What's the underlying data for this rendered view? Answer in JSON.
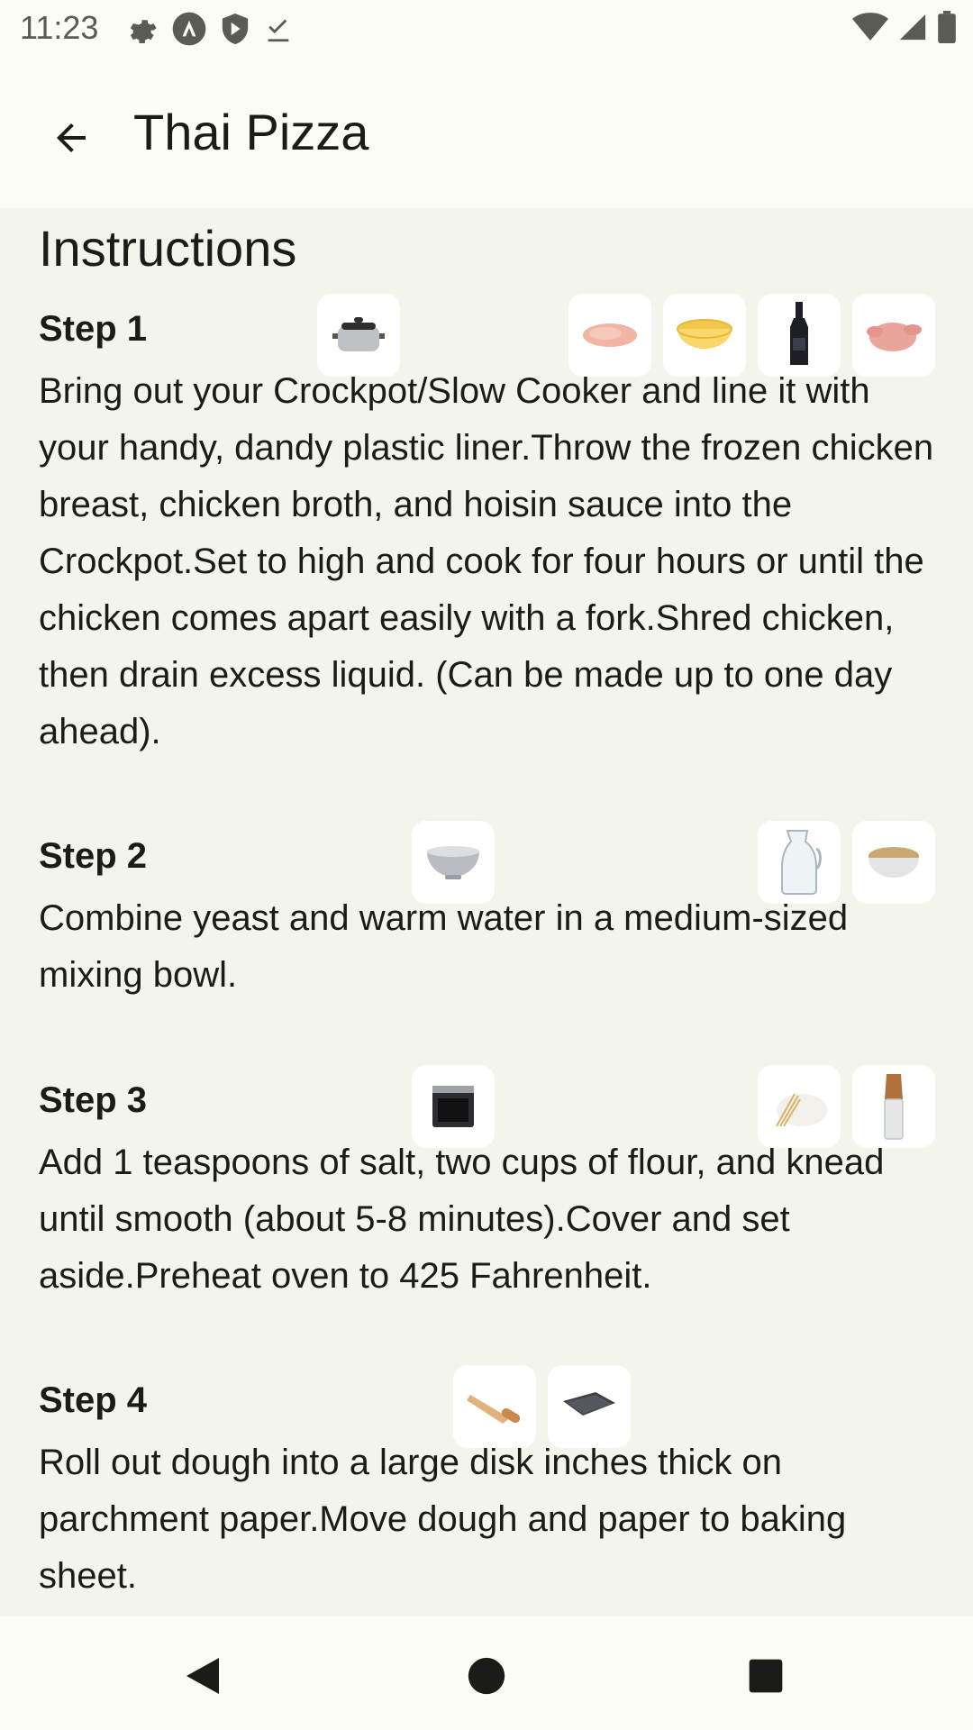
{
  "status_bar": {
    "time": "11:23",
    "icons_left": [
      "gear-icon",
      "a-icon",
      "shield-icon",
      "download-done-icon"
    ],
    "icons_right": [
      "wifi-icon",
      "signal-icon",
      "battery-icon"
    ]
  },
  "app_bar": {
    "back_icon": "arrow-back-icon",
    "title": "Thai Pizza"
  },
  "content": {
    "section_title": "Instructions",
    "steps": [
      {
        "label": "Step 1",
        "equipment": [
          "slow-cooker-image"
        ],
        "ingredients": [
          "chicken-breast-image",
          "chicken-broth-image",
          "hoisin-sauce-image",
          "raw-chicken-image"
        ],
        "text": "Bring out your Crockpot/Slow Cooker and line it with your handy, dandy plastic liner.Throw the frozen chicken breast, chicken broth, and hoisin sauce into the Crockpot.Set to high and cook for four hours or until the chicken comes apart easily with a fork.Shred chicken, then drain excess liquid. (Can be made up to one day ahead)."
      },
      {
        "label": "Step 2",
        "equipment": [
          "mixing-bowl-image"
        ],
        "ingredients": [
          "water-jug-image",
          "yeast-image"
        ],
        "text": "Combine yeast and warm water in a medium-sized mixing bowl."
      },
      {
        "label": "Step 3",
        "equipment": [
          "oven-image"
        ],
        "ingredients": [
          "flour-image",
          "salt-image"
        ],
        "text": "Add 1 teaspoons of salt, two cups of flour, and knead until smooth (about 5-8 minutes).Cover and set aside.Preheat oven to 425 Fahrenheit."
      },
      {
        "label": "Step 4",
        "equipment": [
          "parchment-paper-image",
          "baking-sheet-image"
        ],
        "ingredients": [],
        "text": "Roll out dough into a large disk  inches thick on parchment paper.Move dough and paper to baking sheet."
      }
    ]
  },
  "nav_bar": {
    "icons": [
      "back-triangle-icon",
      "home-circle-icon",
      "recents-square-icon"
    ]
  },
  "colors": {
    "background": "#f3f4ec",
    "bar_background": "#fbfcf5",
    "text": "#1b1c17",
    "card": "#ffffff"
  }
}
